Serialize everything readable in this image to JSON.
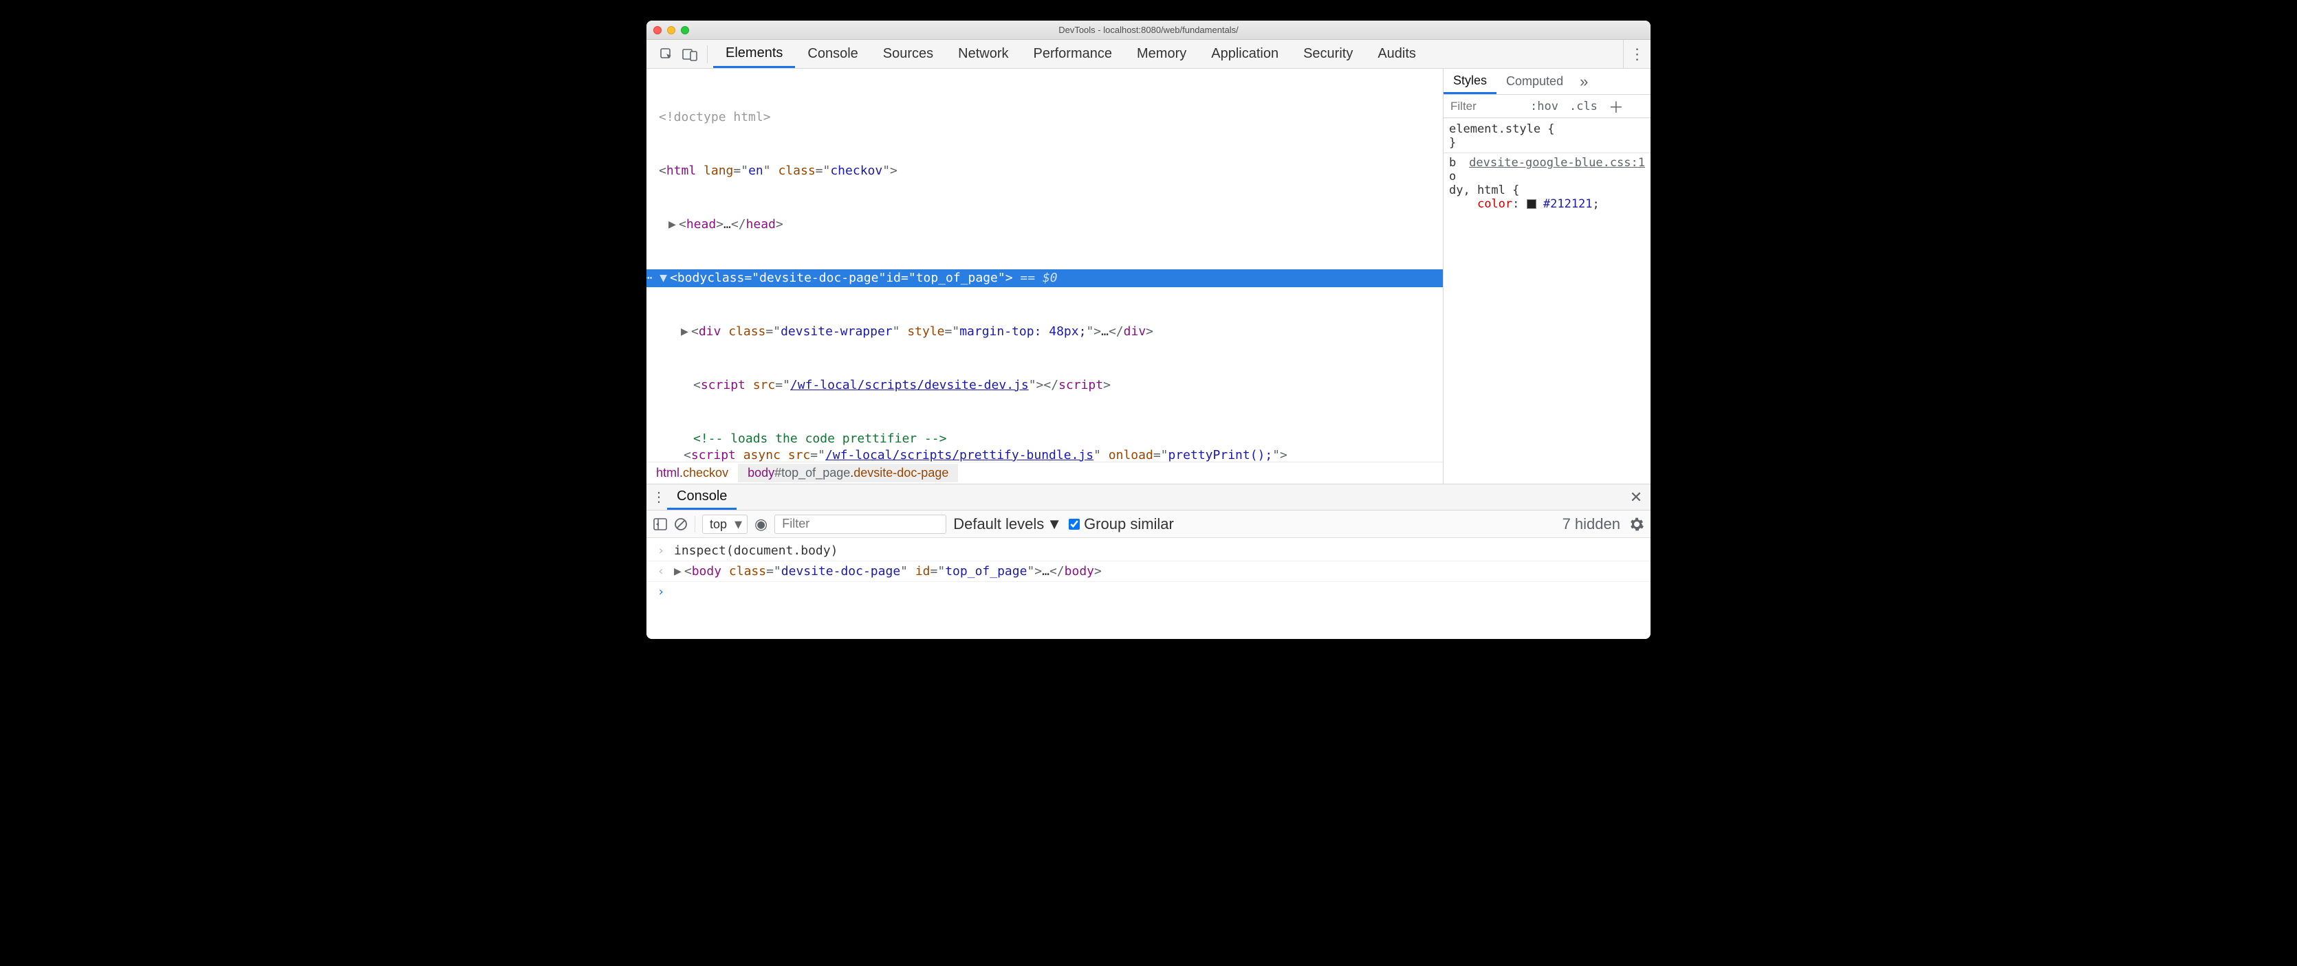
{
  "window": {
    "title": "DevTools - localhost:8080/web/fundamentals/"
  },
  "toolbar": {
    "tabs": [
      "Elements",
      "Console",
      "Sources",
      "Network",
      "Performance",
      "Memory",
      "Application",
      "Security",
      "Audits"
    ],
    "active_tab": "Elements"
  },
  "dom": {
    "doctype": "<!doctype html>",
    "html_open": {
      "lang": "en",
      "class": "checkov"
    },
    "head": "…",
    "body_open": {
      "class": "devsite-doc-page",
      "id": "top_of_page",
      "selected_suffix": " == $0"
    },
    "div": {
      "class": "devsite-wrapper",
      "style": "margin-top: 48px;",
      "content": "…"
    },
    "script1": {
      "src": "/wf-local/scripts/devsite-dev.js"
    },
    "comment": " loads the code prettifier ",
    "script2": {
      "async": true,
      "src": "/wf-local/scripts/prettify-bundle.js",
      "onload": "prettyPrint();"
    }
  },
  "breadcrumbs": [
    {
      "tag": "html",
      "class": "checkov",
      "selected": false
    },
    {
      "tag": "body",
      "id": "top_of_page",
      "class": "devsite-doc-page",
      "selected": true
    }
  ],
  "sidebar": {
    "tabs": [
      "Styles",
      "Computed"
    ],
    "active_tab": "Styles",
    "filter_placeholder": "Filter",
    "hov": ":hov",
    "cls": ".cls",
    "element_style": "element.style",
    "src_label": "devsite-google-blue.css:1",
    "selector_lines": [
      "b",
      "o",
      "dy, html {"
    ],
    "prop": "color",
    "val": "#212121"
  },
  "console": {
    "drawer_title": "Console",
    "context": "top",
    "filter_placeholder": "Filter",
    "levels": "Default levels",
    "group_similar": "Group similar",
    "hidden": "7 hidden",
    "log": {
      "input": "inspect(document.body)",
      "result": {
        "class": "devsite-doc-page",
        "id": "top_of_page",
        "content": "…"
      }
    }
  }
}
